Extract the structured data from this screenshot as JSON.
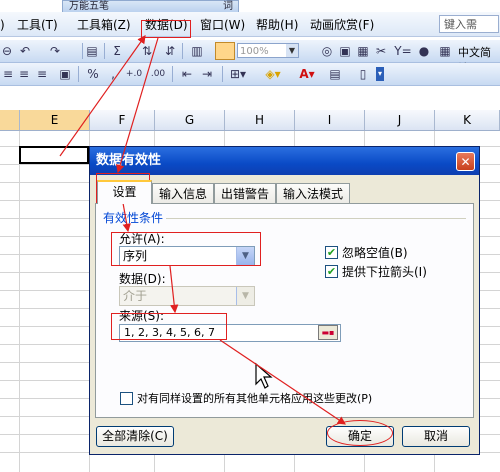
{
  "ime": {
    "name": "万能五笔",
    "extra": "词"
  },
  "menu": {
    "tools": "工具(T)",
    "toolbox": "工具箱(Z)",
    "data": "数据(D)",
    "window": "窗口(W)",
    "help": "帮助(H)",
    "anim": "动画欣赏(F)",
    "help_input_placeholder": "键入需"
  },
  "toolbar": {
    "zoom": "100%",
    "lang": "中文简繁"
  },
  "columns": [
    "E",
    "F",
    "G",
    "H",
    "I",
    "J",
    "K"
  ],
  "dialog": {
    "title": "数据有效性",
    "close": "✕",
    "tabs": [
      "设置",
      "输入信息",
      "出错警告",
      "输入法模式"
    ],
    "group_title": "有效性条件",
    "allow_label": "允许(A):",
    "allow_value": "序列",
    "data_label": "数据(D):",
    "data_value": "介于",
    "ignore_blank": "忽略空值(B)",
    "dropdown": "提供下拉箭头(I)",
    "source_label": "来源(S):",
    "source_value": "1, 2, 3, 4, 5, 6, 7",
    "apply_all": "对有同样设置的所有其他单元格应用这些更改(P)",
    "clear_all": "全部清除(C)",
    "ok": "确定",
    "cancel": "取消"
  },
  "colors": {
    "title_bar": "#0a4ac6",
    "annotation": "#e02020"
  }
}
